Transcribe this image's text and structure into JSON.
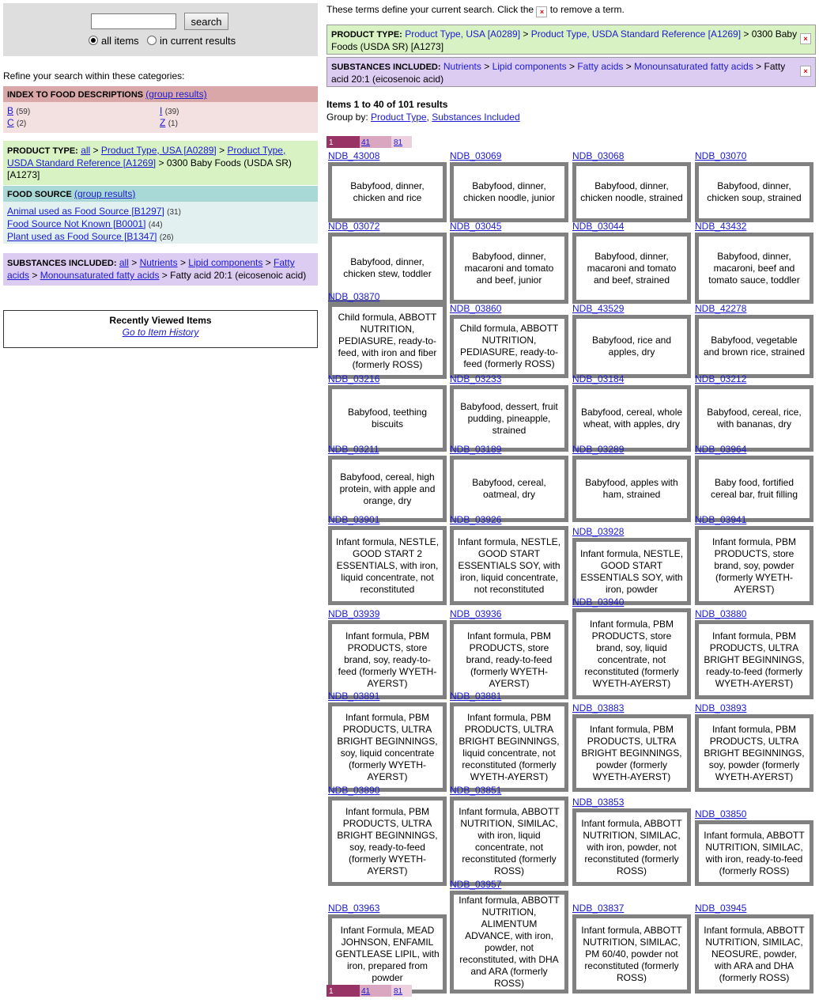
{
  "search": {
    "button": "search",
    "opt_all": "all items",
    "opt_current": "in current results",
    "value": ""
  },
  "refine_label": "Refine your search within these categories:",
  "index": {
    "title": "INDEX TO FOOD DESCRIPTIONS",
    "group_link": "(group results)",
    "letters": [
      {
        "letter": "B",
        "count": "(59)"
      },
      {
        "letter": "I",
        "count": "(39)"
      },
      {
        "letter": "C",
        "count": "(2)"
      },
      {
        "letter": "Z",
        "count": "(1)"
      }
    ]
  },
  "product_type": {
    "title": "PRODUCT TYPE:",
    "all": "all",
    "l1": "Product Type, USA [A0289]",
    "l2": "Product Type, USDA Standard Reference [A1269]",
    "current": "0300 Baby Foods (USDA SR) [A1273]"
  },
  "food_source": {
    "title": "FOOD SOURCE",
    "group_link": "(group results)",
    "items": [
      {
        "label": "Animal used as Food Source [B1297]",
        "count": "(31)"
      },
      {
        "label": "Food Source Not Known [B0001]",
        "count": "(44)"
      },
      {
        "label": "Plant used as Food Source [B1347]",
        "count": "(26)"
      }
    ]
  },
  "substances": {
    "title": "SUBSTANCES INCLUDED:",
    "all": "all",
    "l1": "Nutrients",
    "l2": "Lipid components",
    "l3": "Fatty acids",
    "l4": "Monounsaturated fatty acids",
    "current": "Fatty acid 20:1 (eicosenoic acid)"
  },
  "recent": {
    "title": "Recently Viewed Items",
    "link": "Go to Item History"
  },
  "instructions": {
    "before": "These terms define your current search. Click the",
    "after": "to remove a term."
  },
  "crumb_pt": {
    "title": "PRODUCT TYPE:",
    "l1": "Product Type, USA [A0289]",
    "l2": "Product Type, USDA Standard Reference [A1269]",
    "current": "0300 Baby Foods (USDA SR) [A1273]"
  },
  "crumb_si": {
    "title": "SUBSTANCES INCLUDED:",
    "l1": "Nutrients",
    "l2": "Lipid components",
    "l3": "Fatty acids",
    "l4": "Monounsaturated fatty acids",
    "current": "Fatty acid 20:1 (eicosenoic acid)"
  },
  "remove_glyph": "×",
  "results_count": "Items 1 to 40 of 101 results",
  "group_by": {
    "label": "Group by:",
    "opt1": "Product Type",
    "opt2": "Substances Included"
  },
  "pager": [
    "1",
    "41",
    "81"
  ],
  "items": [
    {
      "id": "NDB_43008",
      "desc": "Babyfood, dinner, chicken and rice"
    },
    {
      "id": "NDB_03069",
      "desc": "Babyfood, dinner, chicken noodle, junior"
    },
    {
      "id": "NDB_03068",
      "desc": "Babyfood, dinner, chicken noodle, strained"
    },
    {
      "id": "NDB_03070",
      "desc": "Babyfood, dinner, chicken soup, strained"
    },
    {
      "id": "NDB_03072",
      "desc": "Babyfood, dinner, chicken stew, toddler"
    },
    {
      "id": "NDB_03045",
      "desc": "Babyfood, dinner, macaroni and tomato and beef, junior"
    },
    {
      "id": "NDB_03044",
      "desc": "Babyfood, dinner, macaroni and tomato and beef, strained"
    },
    {
      "id": "NDB_43432",
      "desc": "Babyfood, dinner, macaroni, beef and tomato sauce, toddler"
    },
    {
      "id": "NDB_03870",
      "desc": "Child formula, ABBOTT NUTRITION, PEDIASURE, ready-to-feed, with iron and fiber (formerly ROSS)"
    },
    {
      "id": "NDB_03860",
      "desc": "Child formula, ABBOTT NUTRITION, PEDIASURE, ready-to-feed (formerly ROSS)"
    },
    {
      "id": "NDB_43529",
      "desc": "Babyfood, rice and apples, dry"
    },
    {
      "id": "NDB_42278",
      "desc": "Babyfood, vegetable and brown rice, strained"
    },
    {
      "id": "NDB_03216",
      "desc": "Babyfood, teething biscuits"
    },
    {
      "id": "NDB_03233",
      "desc": "Babyfood, dessert, fruit pudding, pineapple, strained"
    },
    {
      "id": "NDB_03184",
      "desc": "Babyfood, cereal, whole wheat, with apples, dry"
    },
    {
      "id": "NDB_03212",
      "desc": "Babyfood, cereal, rice, with bananas, dry"
    },
    {
      "id": "NDB_03211",
      "desc": "Babyfood, cereal, high protein, with apple and orange, dry"
    },
    {
      "id": "NDB_03189",
      "desc": "Babyfood, cereal, oatmeal, dry"
    },
    {
      "id": "NDB_03289",
      "desc": "Babyfood, apples with ham, strained"
    },
    {
      "id": "NDB_03964",
      "desc": "Baby food, fortified cereal bar, fruit filling"
    },
    {
      "id": "NDB_03901",
      "desc": "Infant formula, NESTLE, GOOD START 2 ESSENTIALS, with iron, liquid concentrate, not reconstituted"
    },
    {
      "id": "NDB_03926",
      "desc": "Infant formula, NESTLE, GOOD START ESSENTIALS SOY, with iron, liquid concentrate, not reconstituted"
    },
    {
      "id": "NDB_03928",
      "desc": "Infant formula, NESTLE, GOOD START ESSENTIALS SOY, with iron, powder"
    },
    {
      "id": "NDB_03941",
      "desc": "Infant formula, PBM PRODUCTS, store brand, soy, powder (formerly WYETH-AYERST)"
    },
    {
      "id": "NDB_03939",
      "desc": "Infant formula, PBM PRODUCTS, store brand, soy, ready-to-feed (formerly WYETH-AYERST)"
    },
    {
      "id": "NDB_03936",
      "desc": "Infant formula, PBM PRODUCTS, store brand, ready-to-feed (formerly WYETH-AYERST)"
    },
    {
      "id": "NDB_03940",
      "desc": "Infant formula, PBM PRODUCTS, store brand, soy, liquid concentrate, not reconstituted (formerly WYETH-AYERST)"
    },
    {
      "id": "NDB_03880",
      "desc": "Infant formula, PBM PRODUCTS, ULTRA BRIGHT BEGINNINGS, ready-to-feed (formerly WYETH-AYERST)"
    },
    {
      "id": "NDB_03891",
      "desc": "Infant formula, PBM PRODUCTS, ULTRA BRIGHT BEGINNINGS, soy, liquid concentrate (formerly WYETH-AYERST)"
    },
    {
      "id": "NDB_03881",
      "desc": "Infant formula, PBM PRODUCTS, ULTRA BRIGHT BEGINNINGS, liquid concentrate, not reconstituted (formerly WYETH-AYERST)"
    },
    {
      "id": "NDB_03883",
      "desc": "Infant formula, PBM PRODUCTS, ULTRA BRIGHT BEGINNINGS, powder (formerly WYETH-AYERST)"
    },
    {
      "id": "NDB_03893",
      "desc": "Infant formula, PBM PRODUCTS, ULTRA BRIGHT BEGINNINGS, soy, powder (formerly WYETH-AYERST)"
    },
    {
      "id": "NDB_03890",
      "desc": "Infant formula, PBM PRODUCTS, ULTRA BRIGHT BEGINNINGS, soy, ready-to-feed (formerly WYETH-AYERST)"
    },
    {
      "id": "NDB_03851",
      "desc": "Infant formula, ABBOTT NUTRITION, SIMILAC, with iron, liquid concentrate, not reconstituted (formerly ROSS)"
    },
    {
      "id": "NDB_03853",
      "desc": "Infant formula, ABBOTT NUTRITION, SIMILAC, with iron, powder, not reconstituted (formerly ROSS)"
    },
    {
      "id": "NDB_03850",
      "desc": "Infant formula, ABBOTT NUTRITION, SIMILAC, with iron, ready-to-feed (formerly ROSS)"
    },
    {
      "id": "NDB_03963",
      "desc": "Infant Formula, MEAD JOHNSON, ENFAMIL GENTLEASE LIPIL, with iron, prepared from powder"
    },
    {
      "id": "NDB_03957",
      "desc": "Infant formula, ABBOTT NUTRITION, ALIMENTUM ADVANCE, with iron, powder, not reconstituted, with DHA and ARA (formerly ROSS)"
    },
    {
      "id": "NDB_03837",
      "desc": "Infant formula, ABBOTT NUTRITION, SIMILAC, PM 60/40, powder not reconstituted (formerly ROSS)"
    },
    {
      "id": "NDB_03945",
      "desc": "Infant formula, ABBOTT NUTRITION, SIMILAC, NEOSURE, powder, with ARA and DHA (formerly ROSS)"
    }
  ]
}
